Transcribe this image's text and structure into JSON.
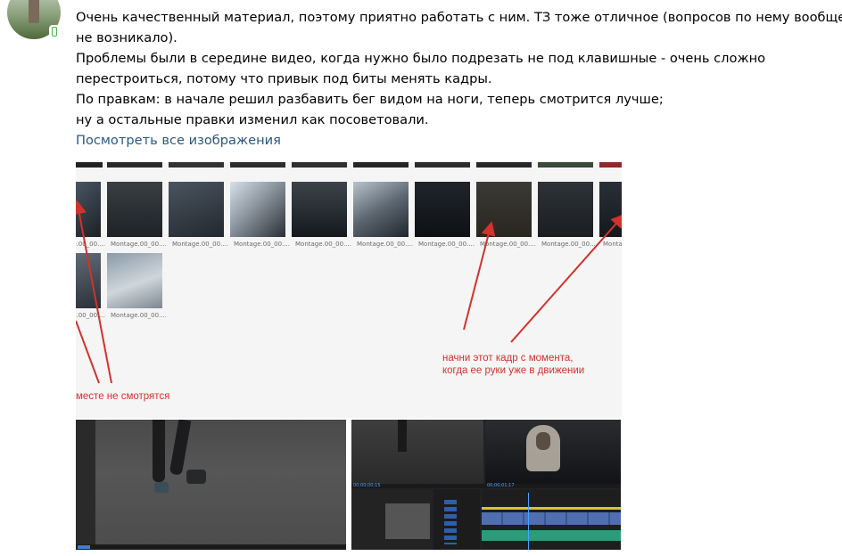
{
  "post": {
    "lines": [
      "Очень качественный материал, поэтому приятно работать с ним. ТЗ тоже отличное (вопросов по нему вообще",
      "не возникало).",
      "Проблемы были в середине видео, когда нужно было подрезать не под клавишные - очень сложно",
      "перестроиться, потому что привык под биты менять кадры.",
      "По правкам: в начале решил разбавить бег видом на ноги, теперь смотрится лучше;",
      "ну а остальные правки изменил как посоветовали."
    ],
    "view_all_link": "Посмотреть все изображения"
  },
  "screenshot1": {
    "thumb_captions": [
      "Montage.00_00....",
      "Montage.00_00....",
      "Montage.00_00....",
      "Montage.00_00....",
      "Montage.00_00....",
      "Montage.00_00....",
      "Montage.00_00....",
      "Montage.00_00....",
      "Montage.00_00....",
      "Montage.00_00....",
      "Montage.00_00....",
      "Montage.00_00....",
      "Montage.00_00...."
    ],
    "annotation_left": "месте не смотрятся",
    "annotation_right_1": "начни этот кадр с момента,",
    "annotation_right_2": "когда ее руки уже в движении",
    "annotation_color": "#d2322d"
  },
  "screenshot3": {
    "timecode_1": "00;00;00;15",
    "timecode_2": "00;00;01;17"
  }
}
